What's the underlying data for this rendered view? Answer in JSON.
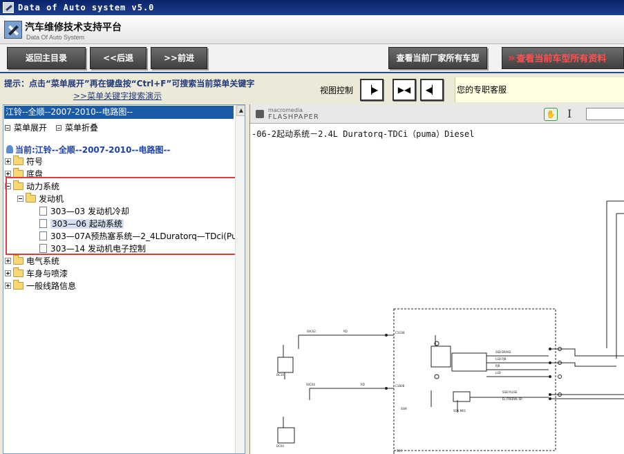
{
  "window": {
    "title": "Data of Auto system v5.0"
  },
  "header": {
    "title": "汽车维修技术支持平台",
    "subtitle": "Data Of Auto System"
  },
  "toolbar": {
    "back_main": "返回主目录",
    "back": "<<后退",
    "forward": ">>前进",
    "all_models_btn": "查看当前厂家所有车型",
    "all_data_btn": "查看当前车型所有资料"
  },
  "hint": {
    "text": "提示：点击“菜单展开”再在键盘按“Ctrl+F”可搜索当前菜单关键字",
    "link": ">>菜单关键字搜索演示",
    "view_control": "视图控制",
    "expert": "您的专职客服"
  },
  "sidebar": {
    "title": "江铃--全顺--2007-2010--电路图--",
    "expand": "菜单展开",
    "collapse": "菜单折叠",
    "current": "当前:江铃--全顺--2007-2010--电路图--",
    "tree": {
      "symbols": "符号",
      "chassis": "底盘",
      "powertrain": "动力系统",
      "engine": "发动机",
      "engine_items": [
        "303—03 发动机冷却",
        "303—06 起动系统",
        "303—07A预热塞系统—2_4LDuratorq—TDci(Pu",
        "303—14 发动机电子控制"
      ],
      "electrical": "电气系统",
      "body": "车身与喷漆",
      "general": "一般线路信息"
    }
  },
  "viewer": {
    "brand_top": "macromedia",
    "brand_bottom": "FLASHPAPER",
    "diagram_title": "-06-2起动系统－2.4L Duratorq-TDCi（puma）Diesel"
  }
}
